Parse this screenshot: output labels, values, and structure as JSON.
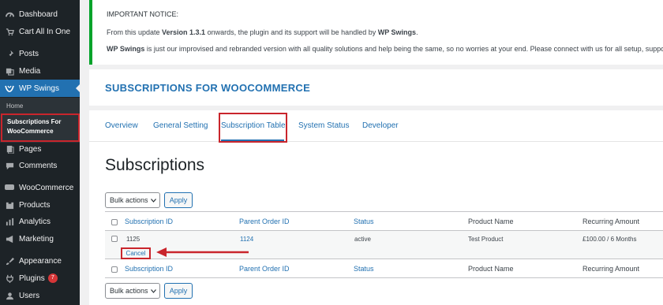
{
  "sidebar": {
    "items": [
      {
        "label": "Dashboard",
        "icon": "dashboard-icon"
      },
      {
        "label": "Cart All In One",
        "icon": "cart-icon"
      },
      {
        "label": "Posts",
        "icon": "pin-icon"
      },
      {
        "label": "Media",
        "icon": "media-icon"
      },
      {
        "label": "WP Swings",
        "icon": "wp-swings-icon"
      },
      {
        "label": "Pages",
        "icon": "pages-icon"
      },
      {
        "label": "Comments",
        "icon": "comments-icon"
      },
      {
        "label": "WooCommerce",
        "icon": "woocommerce-icon"
      },
      {
        "label": "Products",
        "icon": "products-icon"
      },
      {
        "label": "Analytics",
        "icon": "analytics-icon"
      },
      {
        "label": "Marketing",
        "icon": "megaphone-icon"
      },
      {
        "label": "Appearance",
        "icon": "brush-icon"
      },
      {
        "label": "Plugins",
        "icon": "plug-icon",
        "badge": "7"
      },
      {
        "label": "Users",
        "icon": "users-icon"
      }
    ],
    "submenu": {
      "home": "Home",
      "current_line1": "Subscriptions For",
      "current_line2": "WooCommerce"
    }
  },
  "notice": {
    "title": "IMPORTANT NOTICE:",
    "line1_prefix": "From this update ",
    "line1_version": "Version 1.3.1",
    "line1_middle": " onwards, the plugin and its support will be handled by ",
    "line1_brand": "WP Swings",
    "line1_suffix": ".",
    "line2_brand": "WP Swings",
    "line2_text": " is just our improvised and rebranded version with all quality solutions and help being the same, so no worries at your end. Please connect with us for all setup, support, a"
  },
  "header": {
    "title": "SUBSCRIPTIONS FOR WOOCOMMERCE"
  },
  "tabs": [
    "Overview",
    "General Setting",
    "Subscription Table",
    "System Status",
    "Developer"
  ],
  "active_tab": "Subscription Table",
  "page_title": "Subscriptions",
  "bulk": {
    "select_label": "Bulk actions",
    "apply_label": "Apply"
  },
  "table": {
    "columns": [
      "Subscription ID",
      "Parent Order ID",
      "Status",
      "Product Name",
      "Recurring Amount"
    ],
    "rows": [
      {
        "subscription_id": "1125",
        "parent_order_id": "1124",
        "status": "active",
        "product_name": "Test Product",
        "recurring_amount": "£100.00 / 6 Months",
        "action": "Cancel"
      }
    ]
  },
  "colors": {
    "sidebar": "#1d2327",
    "accent": "#2271b1",
    "highlight": "#c9252c",
    "notice_border": "#00a32a"
  }
}
